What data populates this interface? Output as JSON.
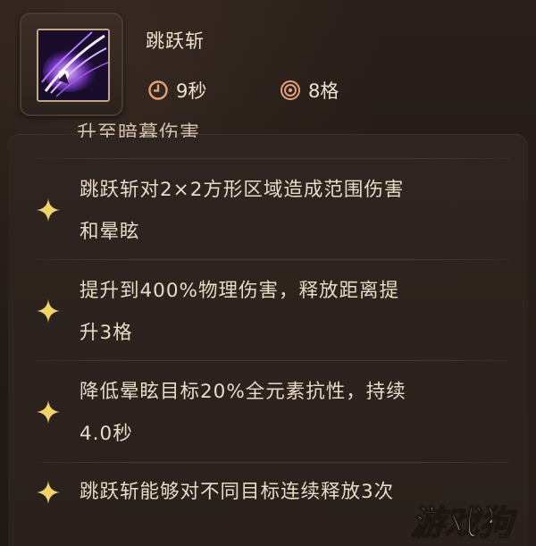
{
  "skill": {
    "name": "跳跃斩",
    "icon": "purple-slash-skill-icon",
    "cooldown_value": "9秒",
    "range_value": "8格",
    "cooldown_icon": "clock-icon",
    "range_icon": "target-icon"
  },
  "partial_line": "升至暗暮伤害",
  "effects": [
    {
      "icon": "sparkle-star-icon",
      "line1": "跳跃斩对2×2方形区域造成范围伤害",
      "line2": "和晕眩"
    },
    {
      "icon": "sparkle-star-icon",
      "line1": "提升到400%物理伤害，释放距离提",
      "line2": "升3格"
    },
    {
      "icon": "sparkle-star-icon",
      "line1": "降低晕眩目标20%全元素抗性，持续",
      "line2": "4.0秒"
    },
    {
      "icon": "sparkle-star-icon",
      "line1": "跳跃斩能够对不同目标连续释放3次",
      "line2": ""
    }
  ],
  "watermark": "游戏狗",
  "colors": {
    "background": "#221a16",
    "panel": "#2f2520",
    "text": "#eadbc6",
    "accent_gold": "#f1d36a",
    "stat_icon": "#e3a07a"
  }
}
